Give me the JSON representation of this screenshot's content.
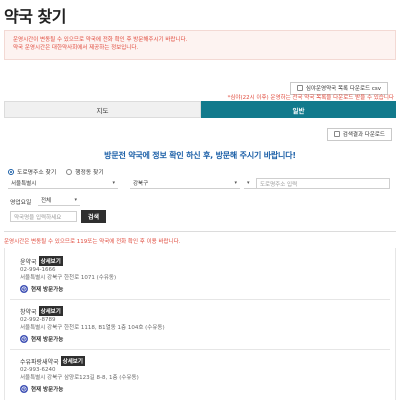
{
  "page_title": "약국 찾기",
  "notice": {
    "line1": "운영시간이 변동될 수 있으므로 약국에 전화 확인 후 방문해주시기 바랍니다.",
    "line2": "약국 운영시간은 대한약사회에서 제공하는 정보입니다."
  },
  "csv_button": {
    "label": "심야운영약국 목록 다운로드 csv",
    "icon": "download-icon"
  },
  "red_note": "*심야(22시 이후) 운영하는 전국 약국 목록을 다운로드 받을 수 있습니다",
  "tabs": [
    {
      "label": "지도",
      "active": false
    },
    {
      "label": "일반",
      "active": true
    }
  ],
  "download_results_button": {
    "label": "검색결과 다운로드",
    "icon": "download-icon"
  },
  "headline": "방문전 약국에 정보 확인 하신 후, 방문해 주시기 바랍니다!",
  "search_mode": {
    "options": [
      "도로명주소 찾기",
      "행정동 찾기"
    ],
    "selected": "도로명주소 찾기"
  },
  "filters": {
    "city": "서울특별시",
    "district": "강북구",
    "road_placeholder": "도로명주소 입력",
    "business_day_label": "영업요일",
    "business_day_value": "전체",
    "name_placeholder": "약국명을 입력하세요",
    "search_label": "검색"
  },
  "result_note": "운영시간은 변동될 수 있으므로 119또는 약국에 전화 확인 후 이용 바랍니다.",
  "results": [
    {
      "name": "윤약국",
      "detail_label": "상세보기",
      "phone": "02-994-1666",
      "address": "서울특별시 강북구 한천로 1071 (수유동)",
      "status": "현재 방문가능"
    },
    {
      "name": "창약국",
      "detail_label": "상세보기",
      "phone": "02-992-8789",
      "address": "서울특별시 강북구 한천로 1118, B1열동 1층 104호 (수유동)",
      "status": "현재 방문가능"
    },
    {
      "name": "수유파랑새약국",
      "detail_label": "상세보기",
      "phone": "02-993-6240",
      "address": "서울특별시 강북구 삼양로123길 8-8, 1층 (수유동)",
      "status": "현재 방문가능"
    }
  ],
  "colors": {
    "accent": "#127a8c",
    "headline": "#1b5fa7",
    "notice_text": "#e04a3c",
    "status_icon": "#3f51b5"
  }
}
